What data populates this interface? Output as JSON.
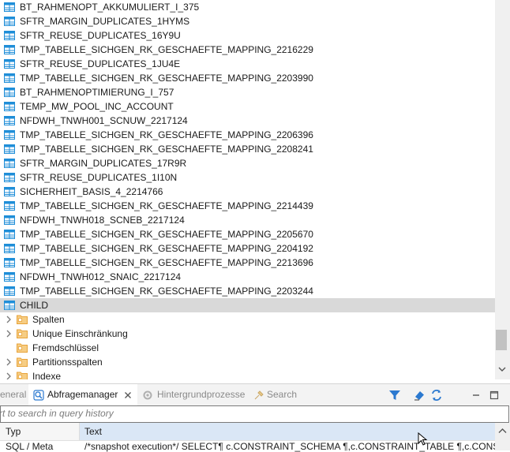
{
  "tree": {
    "tables": [
      "BT_RAHMENOPT_AKKUMULIERT_I_375",
      "SFTR_MARGIN_DUPLICATES_1HYMS",
      "SFTR_REUSE_DUPLICATES_16Y9U",
      "TMP_TABELLE_SICHGEN_RK_GESCHAEFTE_MAPPING_2216229",
      "SFTR_REUSE_DUPLICATES_1JU4E",
      "TMP_TABELLE_SICHGEN_RK_GESCHAEFTE_MAPPING_2203990",
      "BT_RAHMENOPTIMIERUNG_I_757",
      "TEMP_MW_POOL_INC_ACCOUNT",
      "NFDWH_TNWH001_SCNUW_2217124",
      "TMP_TABELLE_SICHGEN_RK_GESCHAEFTE_MAPPING_2206396",
      "TMP_TABELLE_SICHGEN_RK_GESCHAEFTE_MAPPING_2208241",
      "SFTR_MARGIN_DUPLICATES_17R9R",
      "SFTR_REUSE_DUPLICATES_1I10N",
      "SICHERHEIT_BASIS_4_2214766",
      "TMP_TABELLE_SICHGEN_RK_GESCHAEFTE_MAPPING_2214439",
      "NFDWH_TNWH018_SCNEB_2217124",
      "TMP_TABELLE_SICHGEN_RK_GESCHAEFTE_MAPPING_2205670",
      "TMP_TABELLE_SICHGEN_RK_GESCHAEFTE_MAPPING_2204192",
      "TMP_TABELLE_SICHGEN_RK_GESCHAEFTE_MAPPING_2213696",
      "NFDWH_TNWH012_SNAIC_2217124",
      "TMP_TABELLE_SICHGEN_RK_GESCHAEFTE_MAPPING_2203244",
      "CHILD"
    ],
    "children": [
      "Spalten",
      "Unique Einschränkung",
      "Fremdschlüssel",
      "Partitionsspalten",
      "Indexe"
    ]
  },
  "tabs": {
    "general_partial": "eneral",
    "query_manager": "Abfragemanager",
    "background": "Hintergrundprozesse",
    "search": "Search"
  },
  "search": {
    "placeholder": "rt to search in query history"
  },
  "grid": {
    "col_type": "Typ",
    "col_text": "Text",
    "row_type": "SQL / Meta",
    "row_text": "/*snapshot execution*/ SELECT¶ c.CONSTRAINT_SCHEMA ¶,c.CONSTRAINT_TABLE ¶,c.CONSTRAINT_"
  },
  "colors": {
    "selection": "#d9d9d9",
    "table_icon": "#1f8ed8",
    "folder_icon": "#e8a33a",
    "filter_icon": "#2b79d0"
  }
}
